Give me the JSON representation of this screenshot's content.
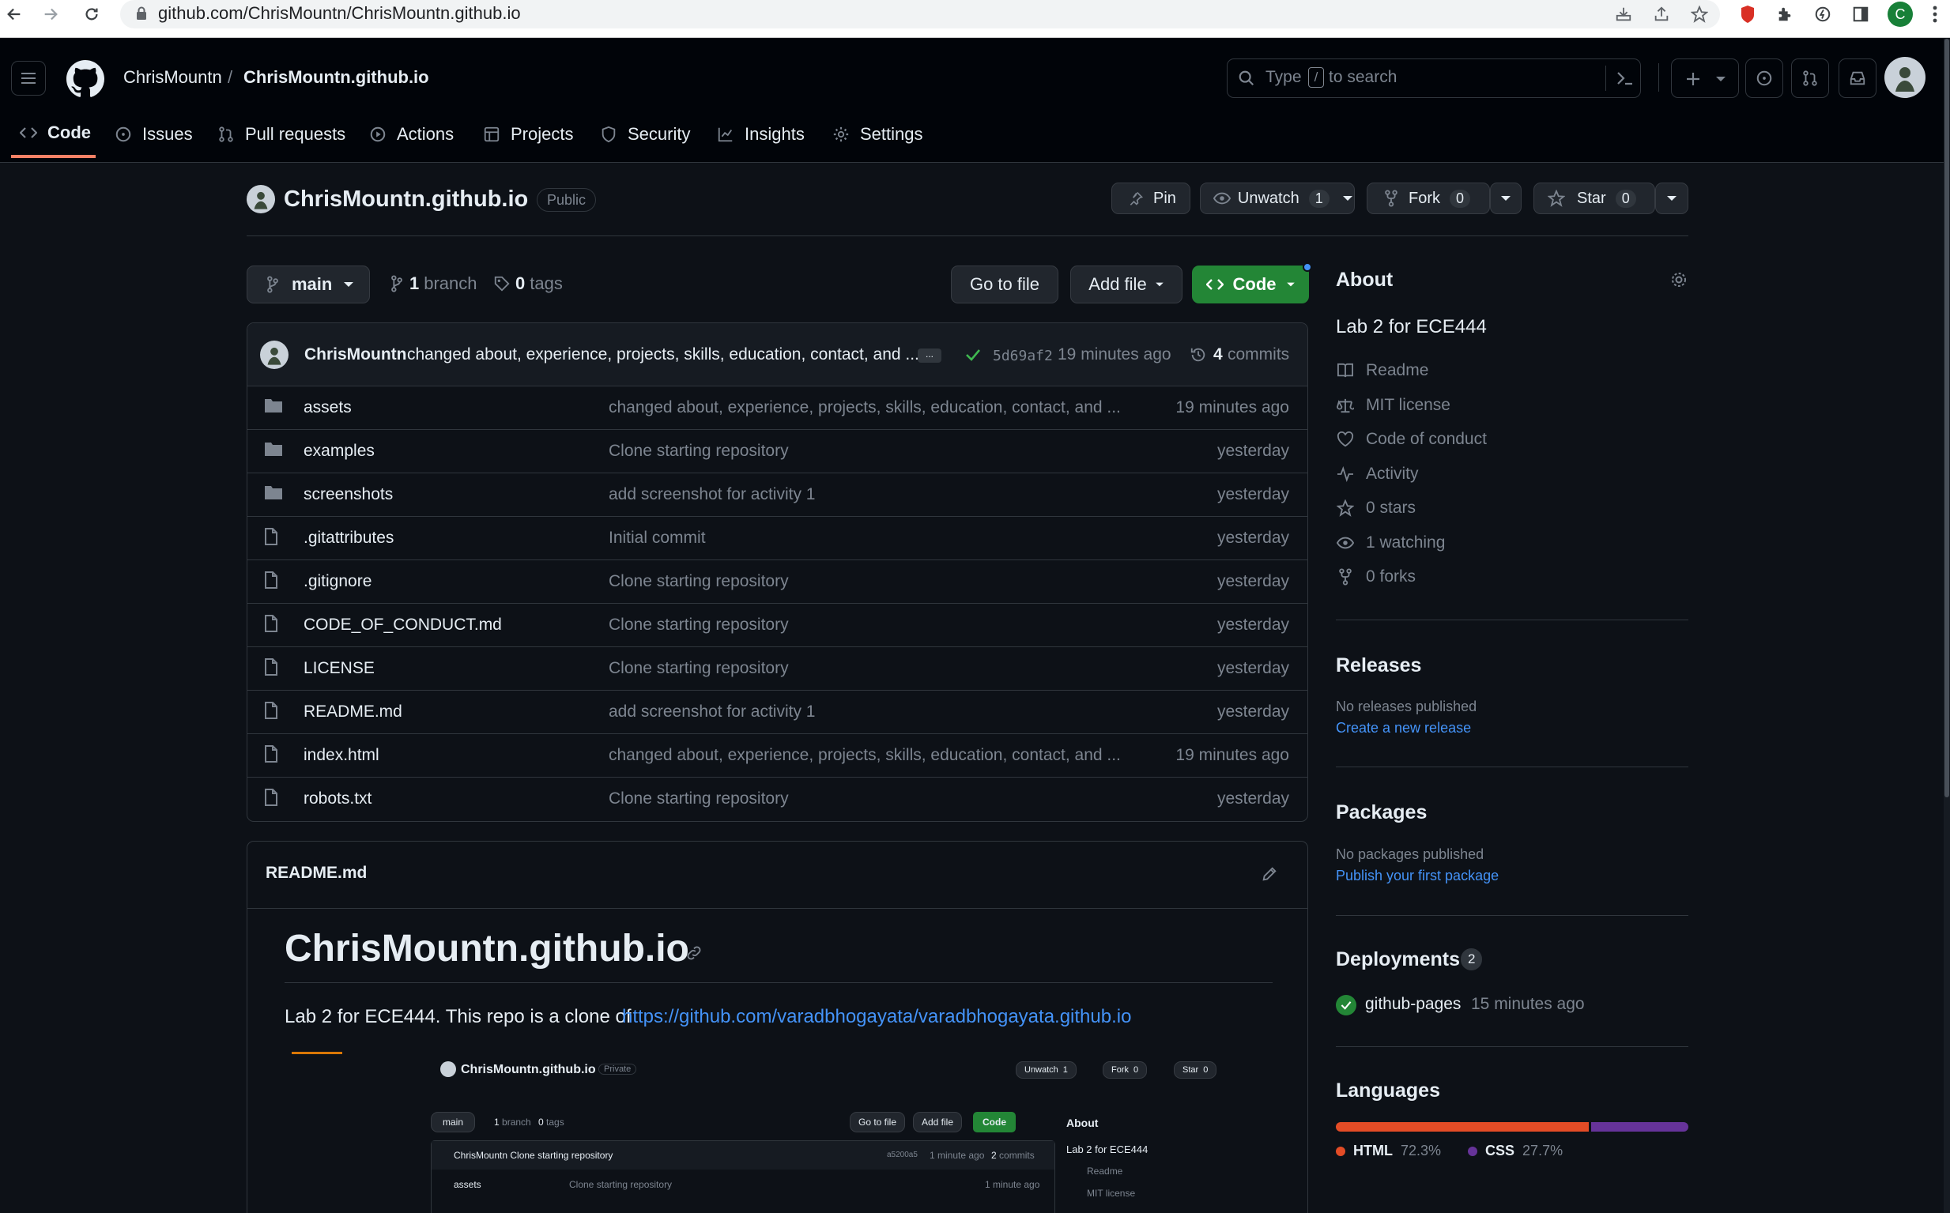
{
  "browser": {
    "url": "github.com/ChrisMountn/ChrisMountn.github.io",
    "profile_initial": "C"
  },
  "header": {
    "owner": "ChrisMountn",
    "separator": "/",
    "repo": "ChrisMountn.github.io",
    "search_type": "Type",
    "search_key": "/",
    "search_rest": "to search"
  },
  "nav_tabs": [
    {
      "label": "Code",
      "icon": "code-icon",
      "selected": true
    },
    {
      "label": "Issues",
      "icon": "issue-icon"
    },
    {
      "label": "Pull requests",
      "icon": "pull-request-icon"
    },
    {
      "label": "Actions",
      "icon": "play-icon"
    },
    {
      "label": "Projects",
      "icon": "table-icon"
    },
    {
      "label": "Security",
      "icon": "shield-icon"
    },
    {
      "label": "Insights",
      "icon": "graph-icon"
    },
    {
      "label": "Settings",
      "icon": "gear-icon"
    }
  ],
  "repo": {
    "name": "ChrisMountn.github.io",
    "visibility": "Public",
    "pin": "Pin",
    "unwatch": "Unwatch",
    "watch_count": "1",
    "fork": "Fork",
    "fork_count": "0",
    "star": "Star",
    "star_count": "0"
  },
  "toolbar": {
    "branch": "main",
    "branch_count": "1",
    "branch_label": "branch",
    "tag_count": "0",
    "tag_label": "tags",
    "go_to_file": "Go to file",
    "add_file": "Add file",
    "code": "Code"
  },
  "commit": {
    "author": "ChrisMountn",
    "message": "changed about, experience, projects, skills, education, contact, and ...",
    "ellipsis": "...",
    "sha": "5d69af2",
    "time": "19 minutes ago",
    "count": "4",
    "count_label": "commits"
  },
  "files": [
    {
      "name": "assets",
      "type": "dir",
      "msg": "changed about, experience, projects, skills, education, contact, and ...",
      "time": "19 minutes ago"
    },
    {
      "name": "examples",
      "type": "dir",
      "msg": "Clone starting repository",
      "time": "yesterday"
    },
    {
      "name": "screenshots",
      "type": "dir",
      "msg": "add screenshot for activity 1",
      "time": "yesterday"
    },
    {
      "name": ".gitattributes",
      "type": "file",
      "msg": "Initial commit",
      "time": "yesterday"
    },
    {
      "name": ".gitignore",
      "type": "file",
      "msg": "Clone starting repository",
      "time": "yesterday"
    },
    {
      "name": "CODE_OF_CONDUCT.md",
      "type": "file",
      "msg": "Clone starting repository",
      "time": "yesterday"
    },
    {
      "name": "LICENSE",
      "type": "file",
      "msg": "Clone starting repository",
      "time": "yesterday"
    },
    {
      "name": "README.md",
      "type": "file",
      "msg": "add screenshot for activity 1",
      "time": "yesterday"
    },
    {
      "name": "index.html",
      "type": "file",
      "msg": "changed about, experience, projects, skills, education, contact, and ...",
      "time": "19 minutes ago"
    },
    {
      "name": "robots.txt",
      "type": "file",
      "msg": "Clone starting repository",
      "time": "yesterday"
    }
  ],
  "readme": {
    "filename": "README.md",
    "title": "ChrisMountn.github.io",
    "text": "Lab 2 for ECE444. This repo is a clone of",
    "link": "https://github.com/varadbhogayata/varadbhogayata.github.io"
  },
  "mini": {
    "repo": "ChrisMountn.github.io",
    "visibility": "Private",
    "unwatch": "Unwatch",
    "watch_count": "1",
    "fork": "Fork",
    "fork_count": "0",
    "star": "Star",
    "star_count": "0",
    "branch": "main",
    "branch_count": "1",
    "branch_label": "branch",
    "tag_count": "0",
    "tag_label": "tags",
    "go_to_file": "Go to file",
    "add_file": "Add file",
    "code": "Code",
    "about": "About",
    "about_desc": "Lab 2 for ECE444",
    "commit_author": "ChrisMountn",
    "commit_msg": "Clone starting repository",
    "sha": "a5200a5",
    "commit_time": "1 minute ago",
    "commit_count": "2",
    "commit_label": "commits",
    "row_name": "assets",
    "row_msg": "Clone starting repository",
    "row_time": "1 minute ago",
    "side1": "Readme",
    "side2": "MIT license"
  },
  "about": {
    "title": "About",
    "description": "Lab 2 for ECE444",
    "items": [
      {
        "label": "Readme",
        "icon": "book-icon"
      },
      {
        "label": "MIT license",
        "icon": "law-icon"
      },
      {
        "label": "Code of conduct",
        "icon": "heart-icon"
      },
      {
        "label": "Activity",
        "icon": "pulse-icon"
      },
      {
        "label": "0 stars",
        "icon": "star-icon"
      },
      {
        "label": "1 watching",
        "icon": "eye-icon"
      },
      {
        "label": "0 forks",
        "icon": "fork-icon"
      }
    ]
  },
  "releases": {
    "title": "Releases",
    "empty": "No releases published",
    "link": "Create a new release"
  },
  "packages": {
    "title": "Packages",
    "empty": "No packages published",
    "link": "Publish your first package"
  },
  "deployments": {
    "title": "Deployments",
    "count": "2",
    "env": "github-pages",
    "time": "15 minutes ago"
  },
  "languages": {
    "title": "Languages",
    "items": [
      {
        "name": "HTML",
        "percent": "72.3%",
        "value": 72.3,
        "color": "#e34c26"
      },
      {
        "name": "CSS",
        "percent": "27.7%",
        "value": 27.7,
        "color": "#663399"
      }
    ]
  },
  "colors": {
    "accent_green": "#238636",
    "link": "#4493f8",
    "bg": "#0d1117"
  }
}
